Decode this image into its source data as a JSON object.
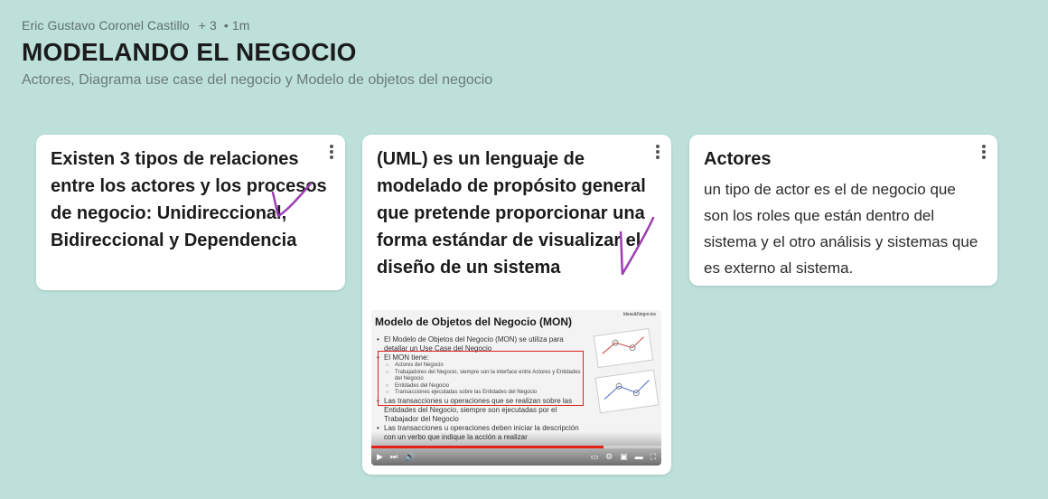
{
  "header": {
    "author": "Eric Gustavo Coronel Castillo",
    "contributors": "+ 3",
    "time": "• 1m",
    "title": "MODELANDO EL NEGOCIO",
    "subtitle": "Actores, Diagrama use case del negocio y Modelo de objetos del negocio"
  },
  "cards": [
    {
      "title": "Existen 3 tipos de relaciones entre los actores y los procesos de negocio: Unidireccional, Bidireccional y Dependencia"
    },
    {
      "title": "(UML) es un lenguaje de modelado de propósito general que pretende proporcionar una forma estándar de visualizar el diseño de un sistema",
      "video": {
        "slide_title": "Modelo de Objetos del Negocio (MON)",
        "logo": "Ideas&Negocios",
        "bullet1": "El Modelo de Objetos del Negocio (MON) se utiliza para detallar un Use Case del Negocio",
        "bullet2": "El MON tiene:",
        "sub1": "Actores del Negocio",
        "sub2": "Trabajadores del Negocio, siempre son la interface entre Actores y Entidades del Negocio",
        "sub3": "Entidades del Negocio",
        "sub4": "Transacciones ejecutadas sobre las Entidades del Negocio",
        "bullet3": "Las transacciones u operaciones que se realizan sobre las Entidades del Negocio, siempre son ejecutadas por el Trabajador del Negocio",
        "bullet4": "Las transacciones u operaciones deben iniciar la descripción con un verbo que indique la acción a realizar",
        "progress": 0.8
      }
    },
    {
      "title": "Actores",
      "body": "un tipo de actor es el de negocio que son los roles que están dentro del sistema y el otro análisis y sistemas que es externo al sistema."
    }
  ],
  "colors": {
    "background": "#bde0da",
    "card": "#ffffff",
    "check": "#9b3fb0",
    "video_progress": "#e62117"
  }
}
